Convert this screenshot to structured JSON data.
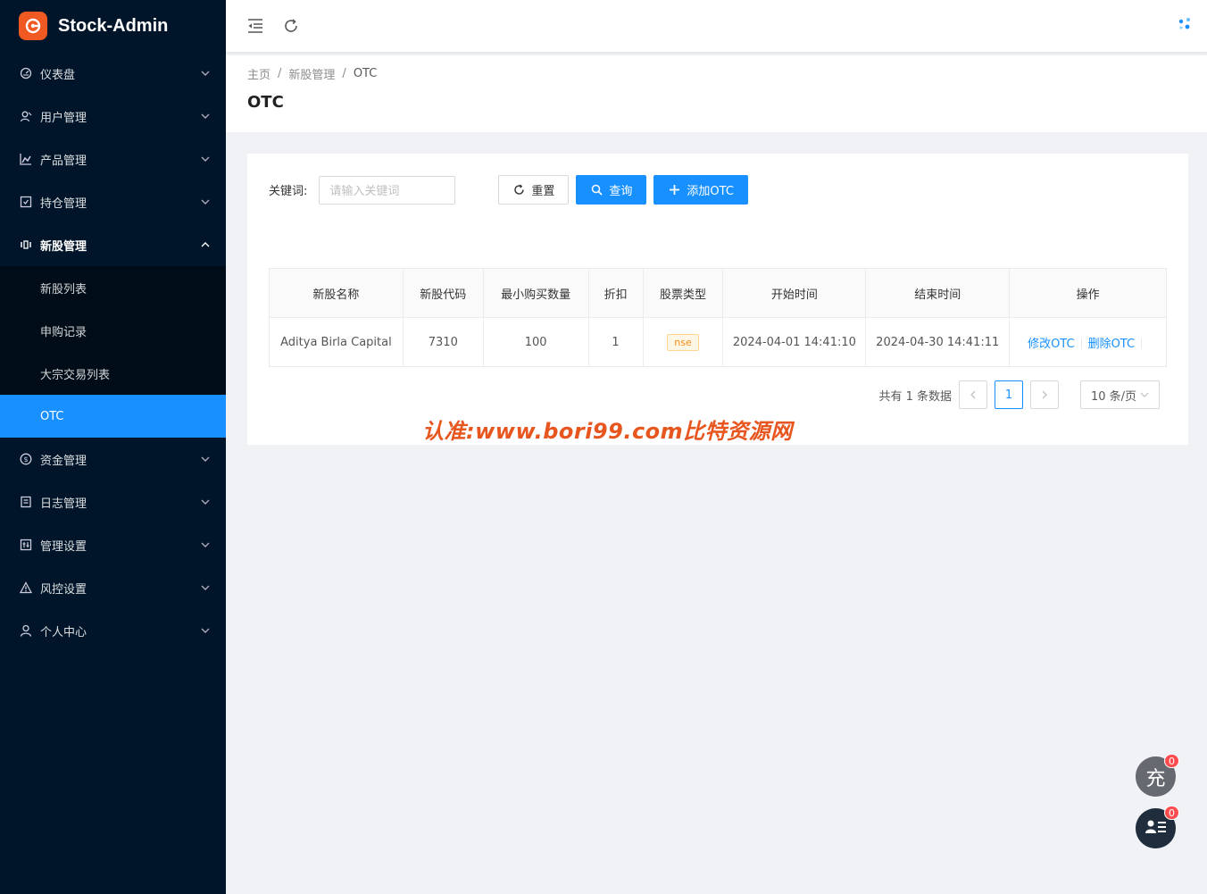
{
  "app": {
    "title": "Stock-Admin"
  },
  "sidebar": {
    "items": [
      {
        "label": "仪表盘",
        "icon": "dashboard-icon"
      },
      {
        "label": "用户管理",
        "icon": "users-icon"
      },
      {
        "label": "产品管理",
        "icon": "chart-icon"
      },
      {
        "label": "持仓管理",
        "icon": "position-icon"
      },
      {
        "label": "新股管理",
        "icon": "ipo-icon",
        "open": true
      },
      {
        "label": "资金管理",
        "icon": "money-icon"
      },
      {
        "label": "日志管理",
        "icon": "log-icon"
      },
      {
        "label": "管理设置",
        "icon": "settings-icon"
      },
      {
        "label": "风控设置",
        "icon": "warning-icon"
      },
      {
        "label": "个人中心",
        "icon": "user-icon"
      }
    ],
    "submenu": [
      {
        "label": "新股列表"
      },
      {
        "label": "申购记录"
      },
      {
        "label": "大宗交易列表"
      },
      {
        "label": "OTC",
        "active": true
      }
    ]
  },
  "breadcrumb": {
    "home": "主页",
    "parent": "新股管理",
    "current": "OTC"
  },
  "page": {
    "title": "OTC"
  },
  "filter": {
    "keyword_label": "关键词:",
    "keyword_placeholder": "请输入关键词",
    "reset_label": "重置",
    "search_label": "查询",
    "add_label": "添加OTC"
  },
  "table": {
    "headers": [
      "新股名称",
      "新股代码",
      "最小购买数量",
      "折扣",
      "股票类型",
      "开始时间",
      "结束时间",
      "操作"
    ],
    "rows": [
      {
        "name": "Aditya Birla Capital",
        "code": "7310",
        "min_qty": "100",
        "discount": "1",
        "type": "nse",
        "start": "2024-04-01 14:41:10",
        "end": "2024-04-30 14:41:11",
        "edit": "修改OTC",
        "delete": "删除OTC"
      }
    ]
  },
  "pagination": {
    "total_text": "共有 1 条数据",
    "current": "1",
    "page_size": "10 条/页"
  },
  "watermark": "认准:www.bori99.com比特资源网",
  "floating": {
    "recharge_label": "充",
    "recharge_badge": "0",
    "support_badge": "0"
  },
  "colors": {
    "sidebar": "#001529",
    "primary": "#1890ff",
    "logo": "#f05a22",
    "watermark": "#e8561f"
  }
}
